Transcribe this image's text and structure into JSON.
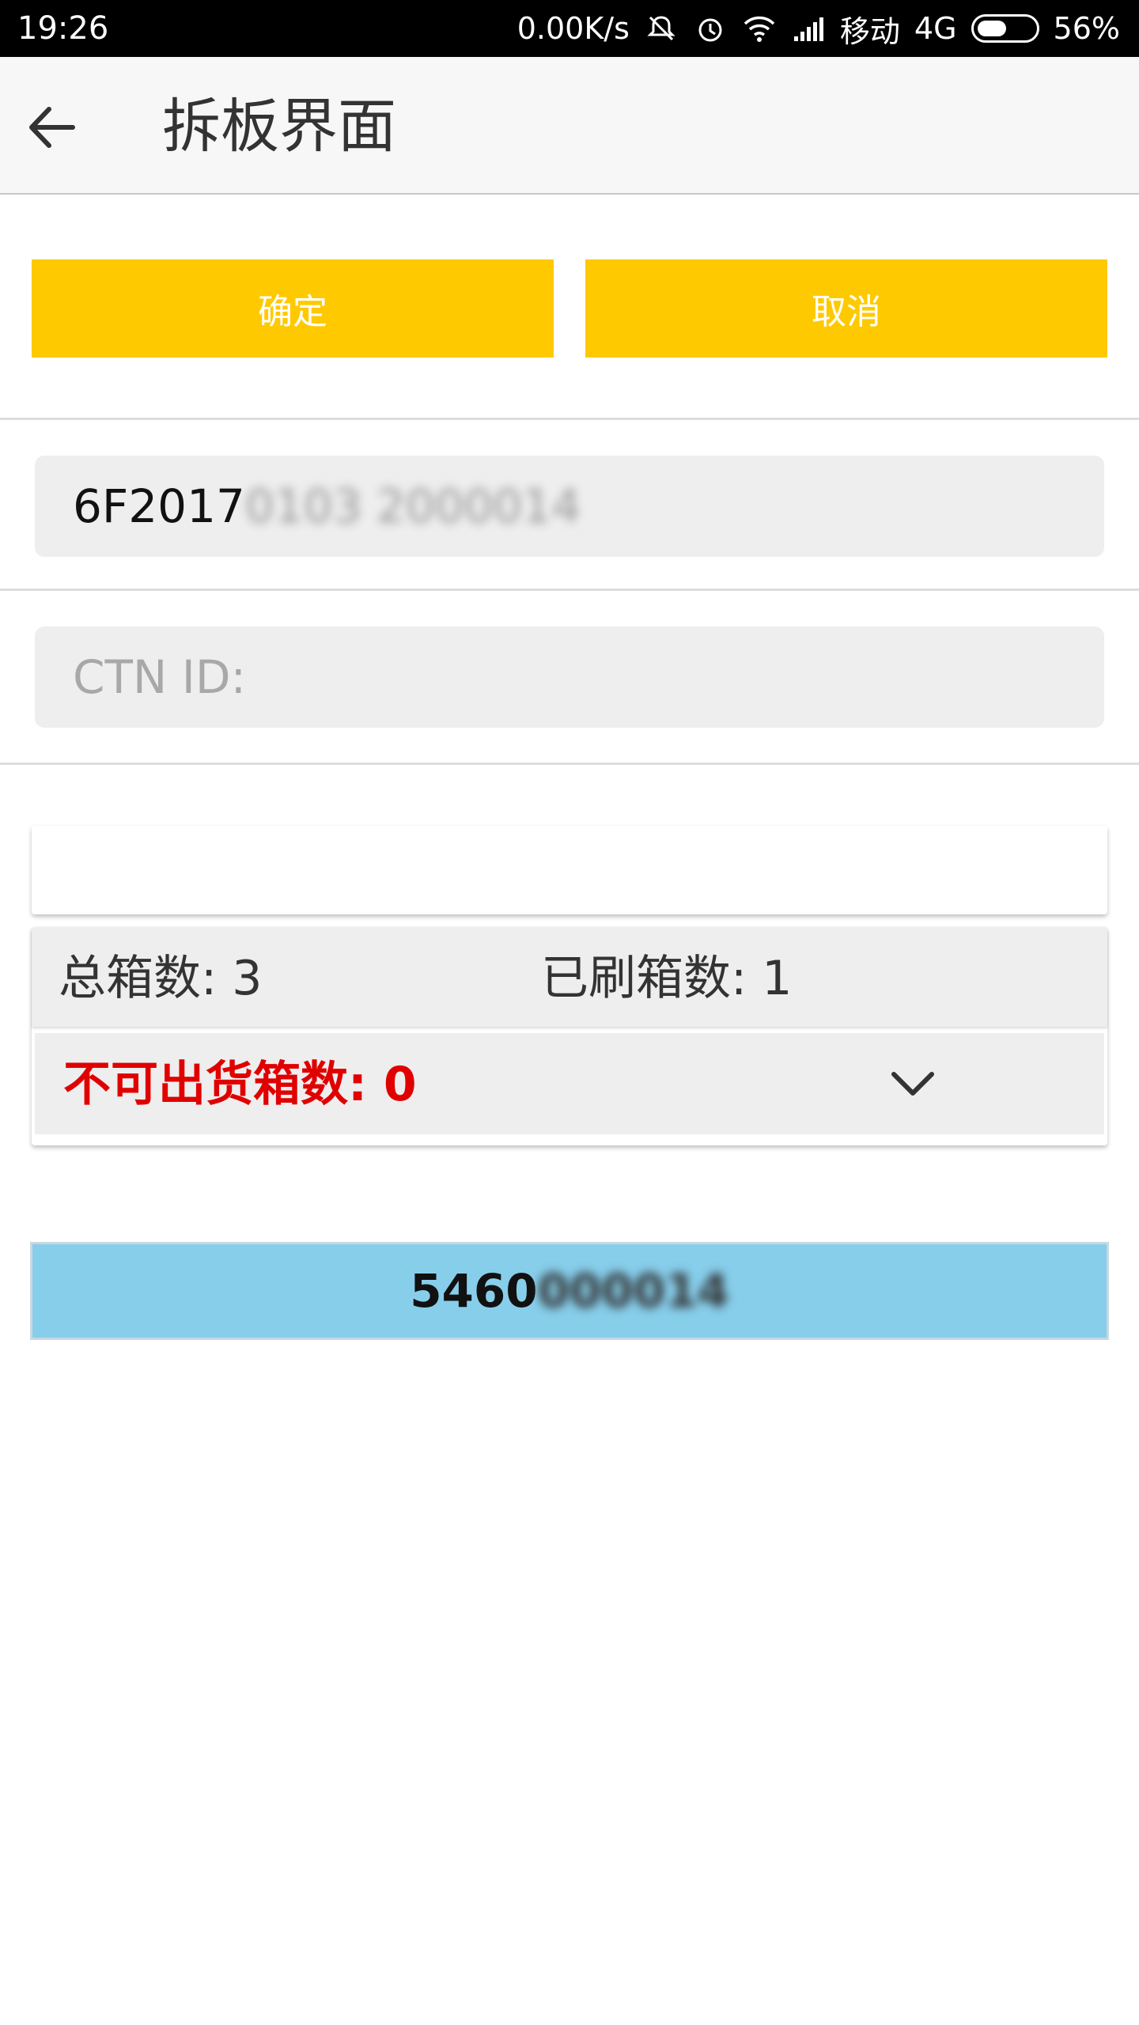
{
  "status_bar": {
    "time": "19:26",
    "net_speed": "0.00K/s",
    "carrier": "移动",
    "network": "4G",
    "battery": "56%",
    "icons": [
      "mute-icon",
      "alarm-icon",
      "wifi-icon",
      "signal-icon",
      "battery-icon"
    ]
  },
  "app_bar": {
    "title": "拆板界面",
    "back_icon": "arrow-left-icon"
  },
  "actions": {
    "confirm_label": "确定",
    "cancel_label": "取消",
    "button_color": "#ffc900"
  },
  "pallet_field": {
    "value_visible": "6F2017",
    "value_obscured": "0103 2000014"
  },
  "ctn_field": {
    "placeholder": "CTN ID:"
  },
  "summary": {
    "total_boxes_label": "总箱数:",
    "total_boxes_value": "3",
    "scanned_boxes_label": "已刷箱数:",
    "scanned_boxes_value": "1",
    "unshippable_label": "不可出货箱数:",
    "unshippable_value": "0",
    "alert_color": "#e00000"
  },
  "boxes": {
    "item_visible": "5460",
    "item_obscured": "000014",
    "row_color": "#87ceeb"
  }
}
